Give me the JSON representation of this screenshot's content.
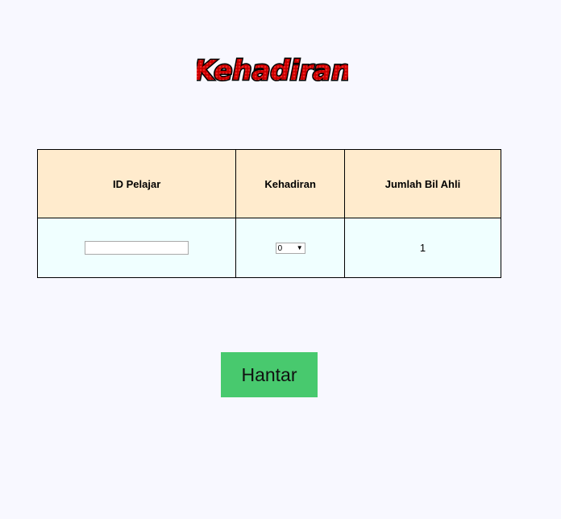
{
  "header": {
    "title_logo_text": "Kehadiran"
  },
  "table": {
    "columns": [
      "ID Pelajar",
      "Kehadiran",
      "Jumlah Bil Ahli"
    ],
    "rows": [
      {
        "id_input_value": "",
        "kehadiran_selected": "0",
        "jumlah_bil_ahli": "1"
      }
    ]
  },
  "form": {
    "submit_label": "Hantar"
  },
  "colors": {
    "page_background": "#f8f8ff",
    "header_row_background": "#ffebcd",
    "body_row_background": "#f0ffff",
    "submit_button_background": "#48c96e",
    "title_fill": "#d40000"
  }
}
